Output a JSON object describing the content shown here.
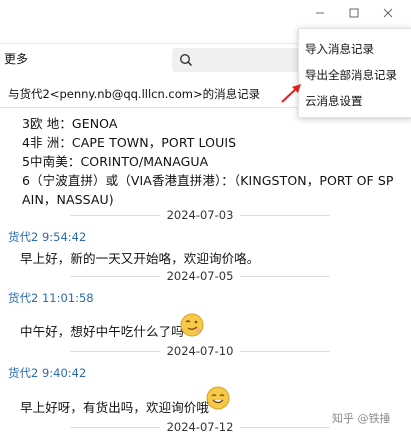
{
  "toolbar": {
    "more_label": "更多",
    "search_value": ""
  },
  "chat": {
    "title": "与货代2<penny.nb@qq.lllcn.com>的消息记录"
  },
  "messages": {
    "block1": [
      "3欧    地：GENOA",
      "4非    洲：CAPE TOWN，PORT LOUIS",
      "5中南美：CORINTO/MANAGUA",
      "6（宁波直拼）或（VIA香港直拼港）：（KINGSTON，PORT OF SP",
      "AIN，NASSAU)"
    ]
  },
  "dates": [
    "2024-07-03",
    "2024-07-05",
    "2024-07-10",
    "2024-07-12"
  ],
  "senders": [
    "货代2 9:54:42",
    "货代2 11:01:58",
    "货代2 9:40:42"
  ],
  "texts": [
    "早上好，新的一天又开始咯，欢迎询价咯。",
    "中午好，想好中午吃什么了吗",
    "早上好呀，有货出吗，欢迎询价哦"
  ],
  "menu": {
    "items": [
      "导入消息记录",
      "导出全部消息记录",
      "云消息设置"
    ]
  },
  "watermark": "知乎 @铁捶",
  "colors": {
    "sender": "#2b6cb0",
    "arrow": "#e02020"
  },
  "icons": [
    "search-icon",
    "minimize-icon",
    "maximize-icon",
    "close-icon",
    "arrow-icon",
    "smiley-icon"
  ]
}
